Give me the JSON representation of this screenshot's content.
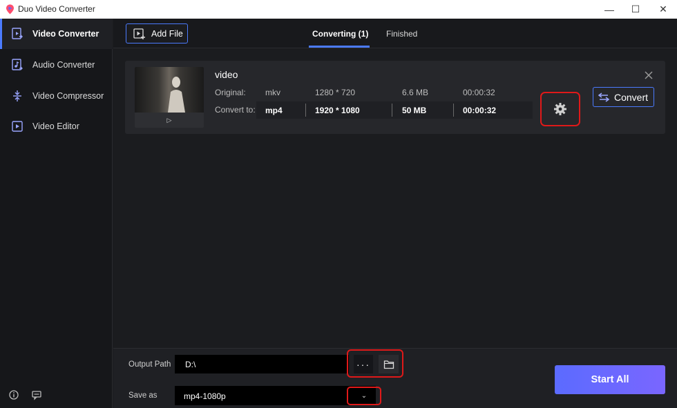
{
  "window": {
    "title": "Duo Video Converter",
    "controls": {
      "minimize": "—",
      "maximize": "☐",
      "close": "✕"
    }
  },
  "sidebar": {
    "items": [
      {
        "label": "Video Converter",
        "icon": "video-converter-icon",
        "active": true
      },
      {
        "label": "Audio Converter",
        "icon": "audio-converter-icon",
        "active": false
      },
      {
        "label": "Video Compressor",
        "icon": "video-compressor-icon",
        "active": false
      },
      {
        "label": "Video Editor",
        "icon": "video-editor-icon",
        "active": false
      }
    ],
    "bottom_icons": [
      "info-icon",
      "feedback-icon"
    ]
  },
  "header": {
    "add_file_label": "Add File",
    "tabs": [
      {
        "label": "Converting (1)",
        "active": true
      },
      {
        "label": "Finished",
        "active": false
      }
    ]
  },
  "file_card": {
    "name": "video",
    "original_label": "Original:",
    "convert_to_label": "Convert to:",
    "play_glyph": "▷",
    "original": {
      "format": "mkv",
      "resolution": "1280 * 720",
      "size": "6.6 MB",
      "duration": "00:00:32"
    },
    "convert_to": {
      "format": "mp4",
      "resolution": "1920 * 1080",
      "size": "50 MB",
      "duration": "00:00:32"
    },
    "convert_button_label": "Convert"
  },
  "footer": {
    "output_path_label": "Output Path",
    "output_path_value": "D:\\",
    "browse_dots": "···",
    "save_as_label": "Save as",
    "save_as_value": "mp4-1080p",
    "dropdown_glyph": "⌄",
    "start_all_label": "Start All"
  },
  "colors": {
    "accent": "#4b7bff",
    "highlight_box": "#e01919",
    "start_all_gradient": [
      "#5b6bff",
      "#7a66ff"
    ]
  }
}
